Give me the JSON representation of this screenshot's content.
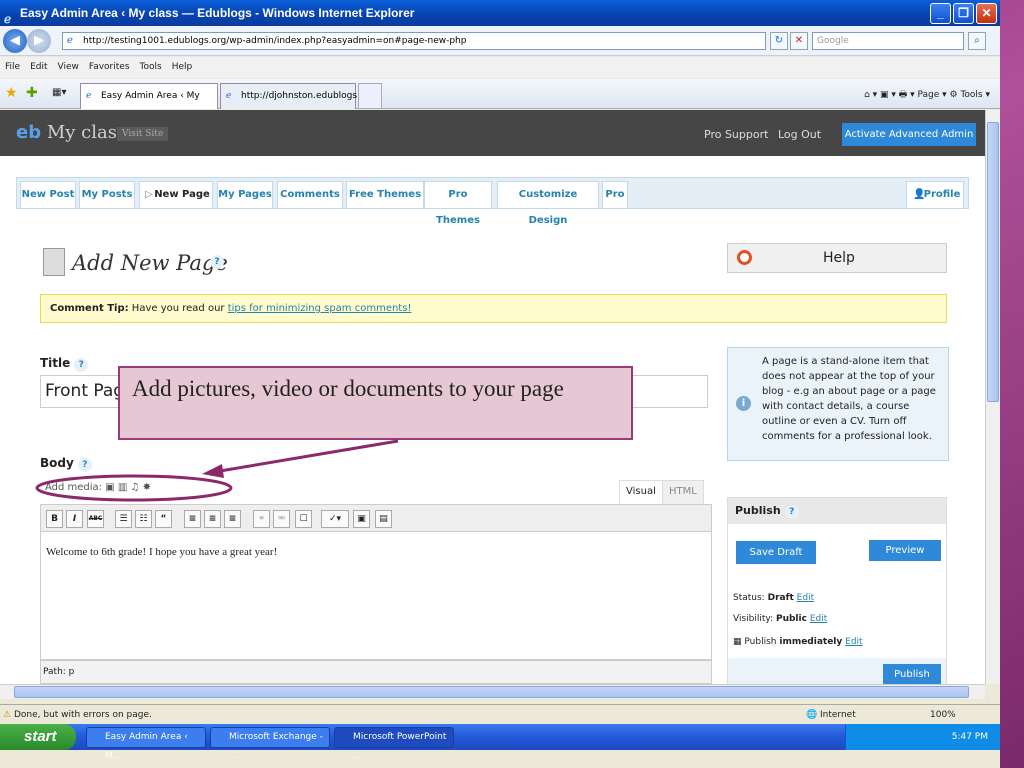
{
  "window": {
    "title": "Easy Admin Area ‹ My class — Edublogs - Windows Internet Explorer",
    "buttons": [
      "_",
      "❐",
      "✕"
    ]
  },
  "browser": {
    "url": "http://testing1001.edublogs.org/wp-admin/index.php?easyadmin=on#page-new-php",
    "search_placeholder": "Google",
    "menu": [
      "File",
      "Edit",
      "View",
      "Favorites",
      "Tools",
      "Help"
    ],
    "tabs": [
      "Easy Admin Area ‹ My cla...",
      "http://djohnston.edublogs.org/"
    ],
    "toolbar_right": "⌂ ▾  ▣ ▾  🖶 ▾  Page ▾  ⚙ Tools ▾"
  },
  "wp": {
    "site_title": "My class",
    "logo": "eb",
    "visit_site": "Visit Site",
    "header_links": [
      "Pro Support",
      "Log Out"
    ],
    "activate": "Activate Advanced Admin",
    "nav": [
      "New Post",
      "My Posts",
      "New Page",
      "My Pages",
      "Comments",
      "Free Themes",
      "Pro Themes",
      "Customize Design",
      "Pro"
    ],
    "profile": "Profile",
    "heading": "Add New Page",
    "help": "Help",
    "tip_label": "Comment Tip:",
    "tip_text": " Have you read our ",
    "tip_link": "tips for minimizing spam comments!",
    "title_label": "Title",
    "title_value": "Front Page",
    "info_html": "A page is a stand-alone item that does not appear at the top of your blog - e.g an about page or a page with contact details, a course outline or even a CV. Turn off comments for a professional look.",
    "body_label": "Body",
    "add_media": "Add media:",
    "media_icons": "▣ ▥ ♫ ✸",
    "visual": "Visual",
    "html": "HTML",
    "editor_text": "Welcome to 6th grade! I hope you have a great year!",
    "path": "Path: p",
    "publish": {
      "heading": "Publish",
      "save_draft": "Save Draft",
      "preview": "Preview",
      "status_label": "Status:",
      "status": "Draft",
      "visibility_label": "Visibility:",
      "visibility": "Public",
      "publish_label": "Publish",
      "publish_when": "immediately",
      "edit": "Edit",
      "publish_btn": "Publish"
    }
  },
  "status_bar": {
    "text": "Done, but with errors on page.",
    "zone": "Internet",
    "zoom": "100%"
  },
  "taskbar": {
    "start": "start",
    "tasks": [
      "Easy Admin Area ‹ M...",
      "Microsoft Exchange - ...",
      "Microsoft PowerPoint ..."
    ],
    "time": "5:47 PM"
  },
  "callout": {
    "text": "Add pictures, video or documents to your page"
  }
}
